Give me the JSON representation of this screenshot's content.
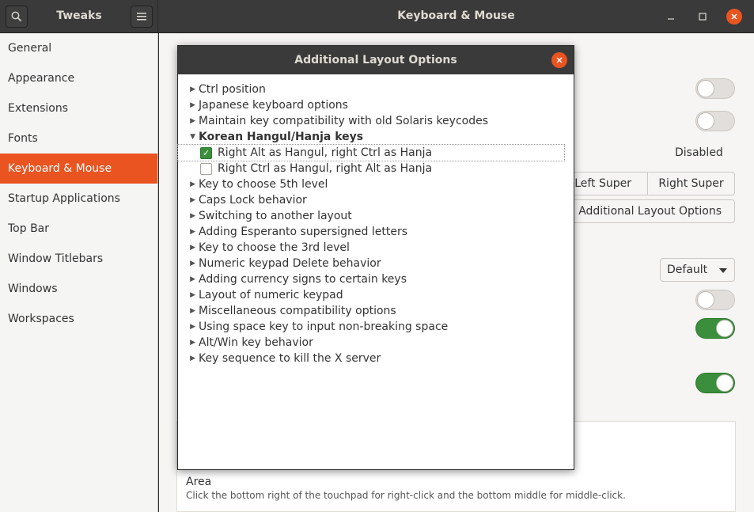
{
  "app": {
    "sidebar_title": "Tweaks",
    "window_title": "Keyboard & Mouse"
  },
  "sidebar": {
    "items": [
      {
        "label": "General",
        "active": false
      },
      {
        "label": "Appearance",
        "active": false
      },
      {
        "label": "Extensions",
        "active": false
      },
      {
        "label": "Fonts",
        "active": false
      },
      {
        "label": "Keyboard & Mouse",
        "active": true
      },
      {
        "label": "Startup Applications",
        "active": false
      },
      {
        "label": "Top Bar",
        "active": false
      },
      {
        "label": "Window Titlebars",
        "active": false
      },
      {
        "label": "Windows",
        "active": false
      },
      {
        "label": "Workspaces",
        "active": false
      }
    ]
  },
  "main": {
    "disabled_label": "Disabled",
    "left_super": "Left Super",
    "right_super": "Right Super",
    "additional_layout_button": "Additional Layout Options",
    "dropdown_value": "Default",
    "area_title": "Area",
    "area_desc": "Click the bottom right of the touchpad for right-click and the bottom middle for middle-click.",
    "toggles": [
      {
        "state": "off"
      },
      {
        "state": "off"
      },
      {
        "state": "off"
      },
      {
        "state": "on"
      },
      {
        "state": "on"
      }
    ]
  },
  "dialog": {
    "title": "Additional Layout Options",
    "rows": [
      {
        "label": "Ctrl position"
      },
      {
        "label": "Japanese keyboard options"
      },
      {
        "label": "Maintain key compatibility with old Solaris keycodes"
      },
      {
        "label": "Korean Hangul/Hanja keys",
        "expanded": true
      },
      {
        "label": "Key to choose 5th level"
      },
      {
        "label": "Caps Lock behavior"
      },
      {
        "label": "Switching to another layout"
      },
      {
        "label": "Adding Esperanto supersigned letters"
      },
      {
        "label": "Key to choose the 3rd level"
      },
      {
        "label": "Numeric keypad Delete behavior"
      },
      {
        "label": "Adding currency signs to certain keys"
      },
      {
        "label": "Layout of numeric keypad"
      },
      {
        "label": "Miscellaneous compatibility options"
      },
      {
        "label": "Using space key to input non-breaking space"
      },
      {
        "label": "Alt/Win key behavior"
      },
      {
        "label": "Key sequence to kill the X server"
      }
    ],
    "korean_options": [
      {
        "label": "Right Alt as Hangul, right Ctrl as Hanja",
        "checked": true
      },
      {
        "label": "Right Ctrl as Hangul, right Alt as Hanja",
        "checked": false
      }
    ]
  }
}
